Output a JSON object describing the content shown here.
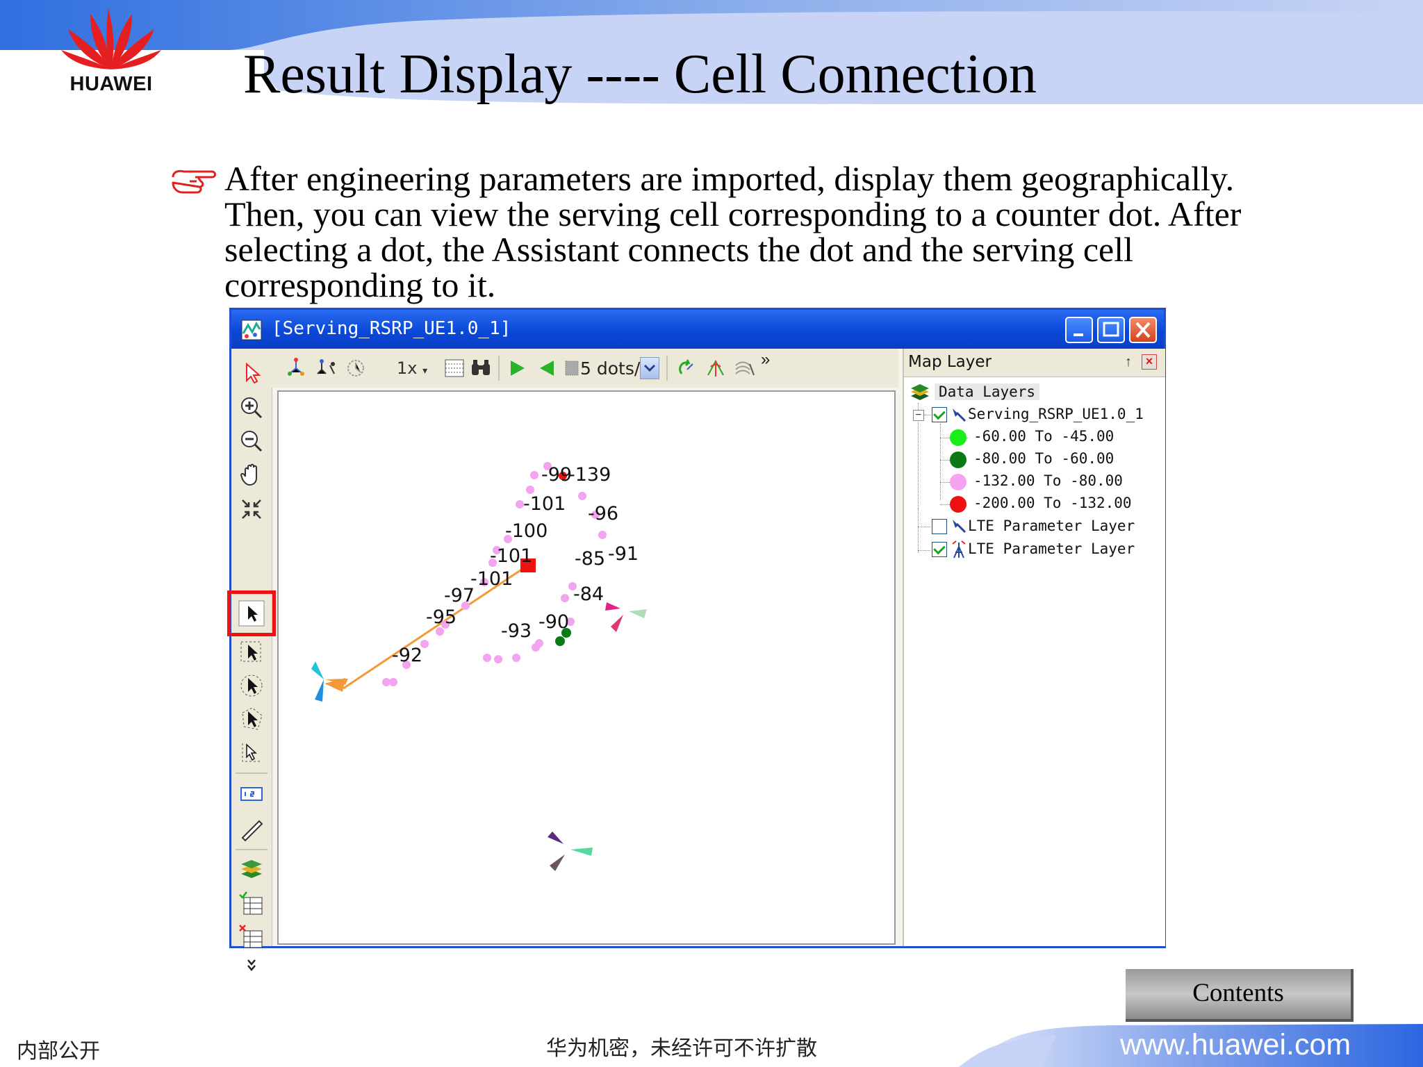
{
  "slide": {
    "logo_text": "HUAWEI",
    "title": "Result Display ---- Cell Connection",
    "body": "After engineering parameters are imported, display them geographically. Then, you can view the serving cell corresponding to a counter dot. After selecting a dot, the Assistant connects the dot and the serving cell corresponding to it."
  },
  "window": {
    "title": "[Serving_RSRP_UE1.0_1]",
    "toolbar": {
      "zoom_label": "1x",
      "speed_value": "5 dots/s",
      "overflow": "»"
    },
    "left_tools": [
      "pointer",
      "zoom-in",
      "zoom-out",
      "pan",
      "fit",
      "select",
      "rect-select",
      "circle-select",
      "polygon-select",
      "cell-select",
      "measure-1-2",
      "ruler",
      "layers",
      "table-1",
      "table-2",
      "more"
    ]
  },
  "map_labels": [
    "-99",
    "-139",
    "-101",
    "-96",
    "-100",
    "-101",
    "-85",
    "-91",
    "-101",
    "-84",
    "-97",
    "-95",
    "-90",
    "-93",
    "-92"
  ],
  "layer_panel": {
    "title": "Map Layer",
    "pin": "ᚔ",
    "root": "Data Layers",
    "layer1": "Serving_RSRP_UE1.0_1",
    "legend": [
      {
        "label": "-60.00 To -45.00",
        "color": "#1aee1a"
      },
      {
        "label": "-80.00 To -60.00",
        "color": "#0a7a16"
      },
      {
        "label": "-132.00 To -80.00",
        "color": "#f3a3ef"
      },
      {
        "label": "-200.00 To -132.00",
        "color": "#ee1111"
      }
    ],
    "layer2": "LTE Parameter Layer",
    "layer3": "LTE Parameter Layer"
  },
  "footer": {
    "contents": "Contents",
    "left": "内部公开",
    "middle": "华为机密，未经许可不许扩散",
    "url": "www.huawei.com"
  }
}
